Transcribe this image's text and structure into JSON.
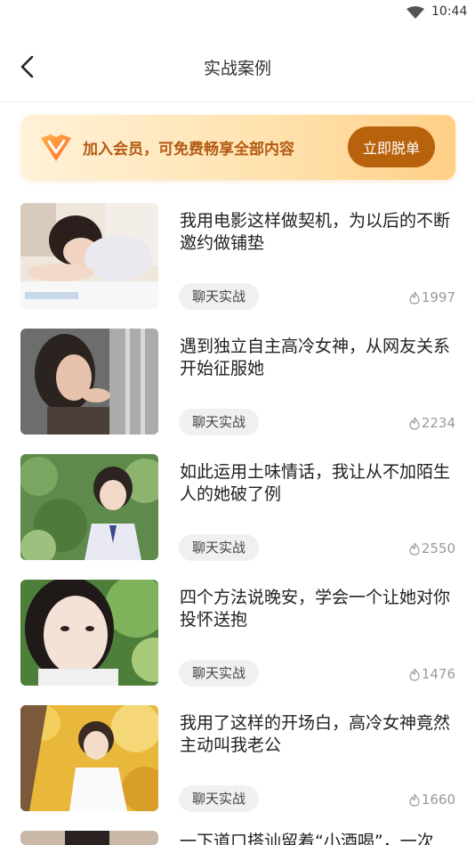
{
  "status": {
    "time": "10:44"
  },
  "header": {
    "title": "实战案例"
  },
  "banner": {
    "text": "加入会员，可免费畅享全部内容",
    "button": "立即脱单"
  },
  "articles": [
    {
      "title": "我用电影这样做契机，为以后的不断邀约做铺垫",
      "tag": "聊天实战",
      "views": "1997"
    },
    {
      "title": "遇到独立自主高冷女神，从网友关系开始征服她",
      "tag": "聊天实战",
      "views": "2234"
    },
    {
      "title": "如此运用土味情话，我让从不加陌生人的她破了例",
      "tag": "聊天实战",
      "views": "2550"
    },
    {
      "title": "四个方法说晚安，学会一个让她对你投怀送抱",
      "tag": "聊天实战",
      "views": "1476"
    },
    {
      "title": "我用了这样的开场白，高冷女神竟然主动叫我老公",
      "tag": "聊天实战",
      "views": "1660"
    },
    {
      "title": "一下道口搭讪留着“小酒喝”，一次",
      "tag": "",
      "views": ""
    }
  ],
  "colors": {
    "accent": "#b8620d",
    "banner_text": "#b35a14"
  }
}
